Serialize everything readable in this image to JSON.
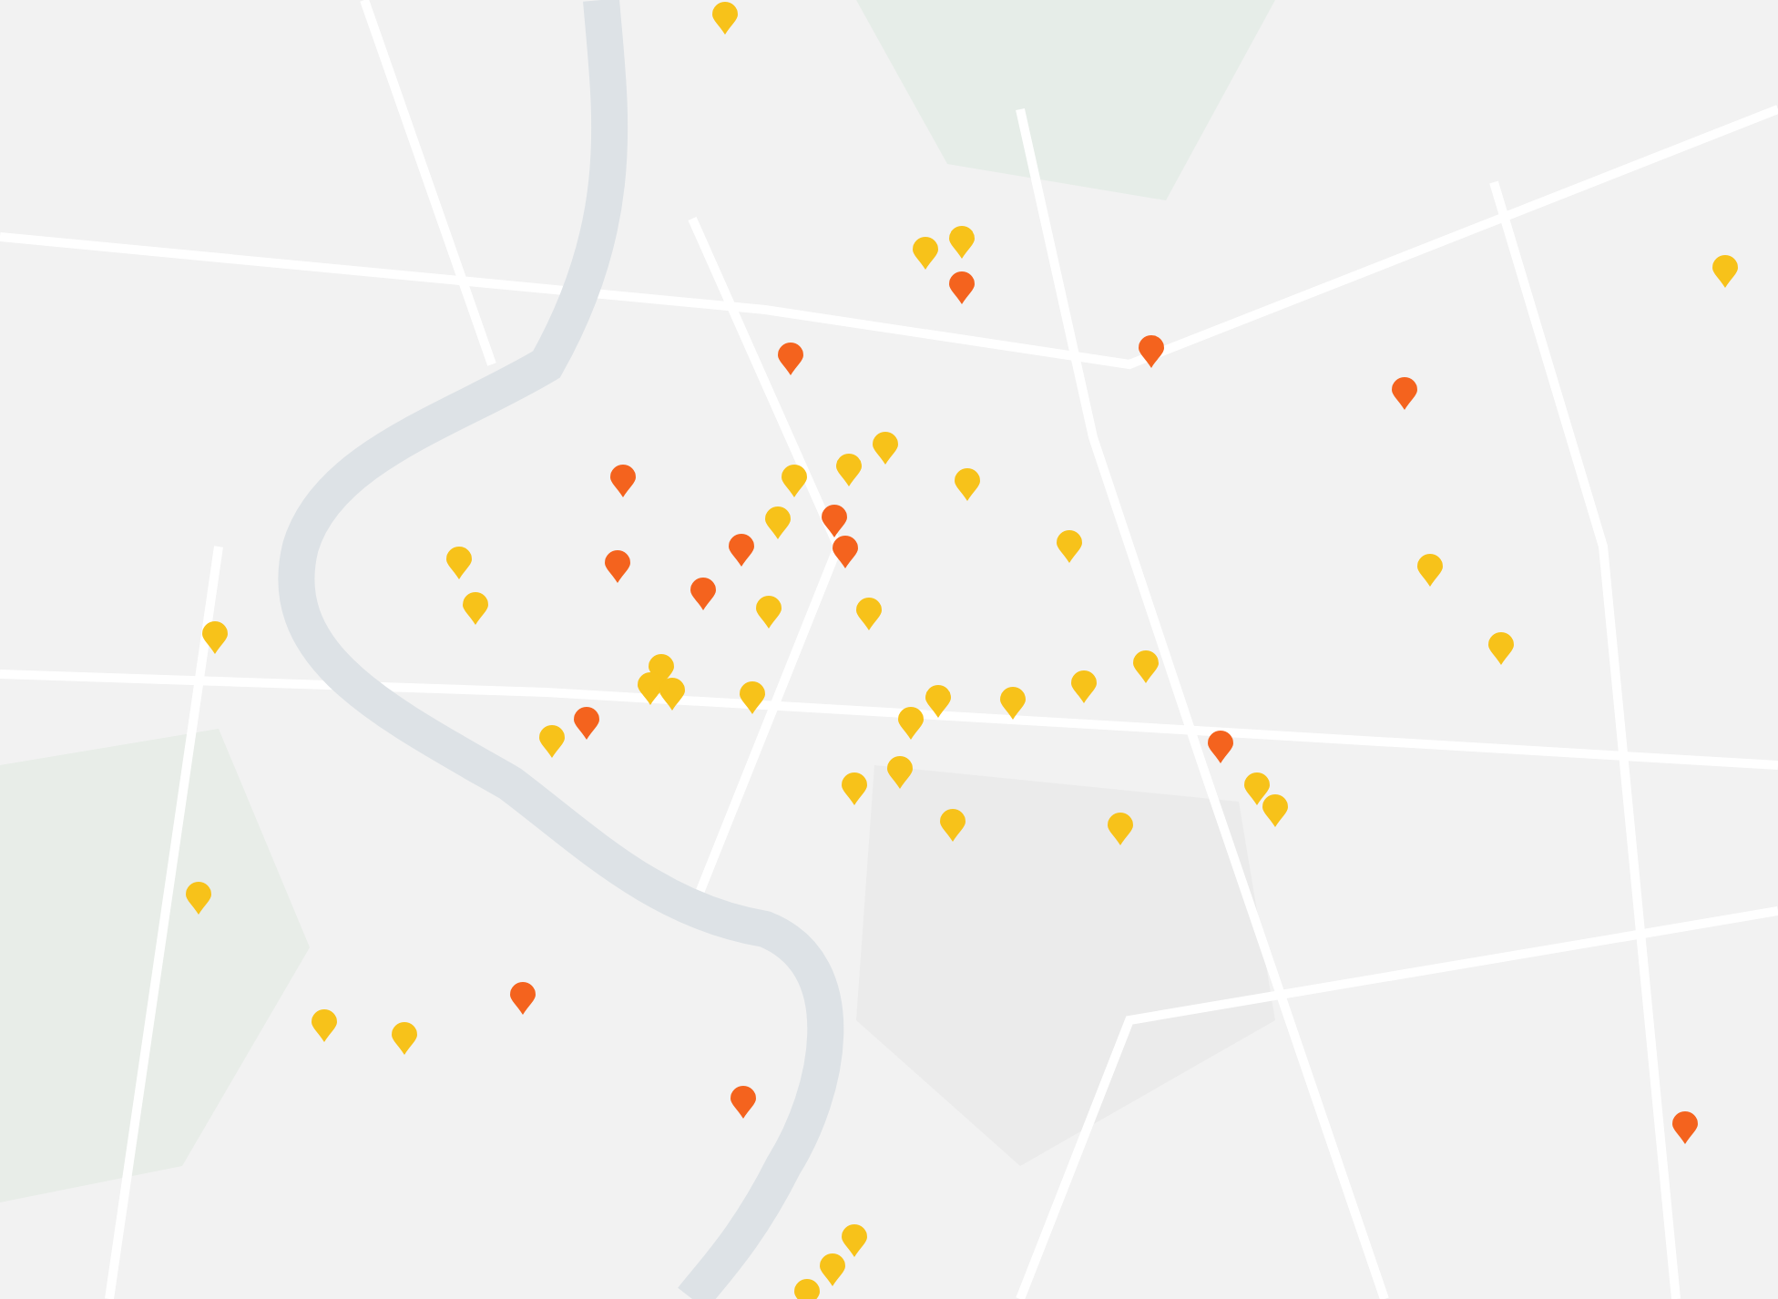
{
  "map": {
    "markers": [
      {
        "color": "#f7c21a"
      },
      {
        "color": "#f7c21a"
      },
      {
        "color": "#f7c21a"
      },
      {
        "color": "#f7c21a"
      },
      {
        "color": "#f7c21a"
      },
      {
        "color": "#f7c21a"
      },
      {
        "color": "#f7c21a"
      },
      {
        "color": "#f7c21a"
      },
      {
        "color": "#f7c21a"
      },
      {
        "color": "#f7c21a"
      },
      {
        "color": "#f7c21a"
      },
      {
        "color": "#f7c21a"
      },
      {
        "color": "#f7c21a"
      },
      {
        "color": "#f7c21a"
      },
      {
        "color": "#f7c21a"
      },
      {
        "color": "#f7c21a"
      },
      {
        "color": "#f7c21a"
      },
      {
        "color": "#f7c21a"
      },
      {
        "color": "#f7c21a"
      },
      {
        "color": "#f7c21a"
      },
      {
        "color": "#f7c21a"
      },
      {
        "color": "#f7c21a"
      },
      {
        "color": "#f7c21a"
      },
      {
        "color": "#f7c21a"
      },
      {
        "color": "#f7c21a"
      },
      {
        "color": "#f7c21a"
      },
      {
        "color": "#f7c21a"
      },
      {
        "color": "#f7c21a"
      },
      {
        "color": "#f7c21a"
      },
      {
        "color": "#f7c21a"
      },
      {
        "color": "#f7c21a"
      },
      {
        "color": "#f7c21a"
      },
      {
        "color": "#f7c21a"
      },
      {
        "color": "#f7c21a"
      },
      {
        "color": "#f7c21a"
      },
      {
        "color": "#f7c21a"
      },
      {
        "color": "#f7c21a"
      },
      {
        "color": "#f7c21a"
      },
      {
        "color": "#f7c21a"
      },
      {
        "color": "#f4631e"
      },
      {
        "color": "#f4631e"
      },
      {
        "color": "#f4631e"
      },
      {
        "color": "#f4631e"
      },
      {
        "color": "#f4631e"
      },
      {
        "color": "#f4631e"
      },
      {
        "color": "#f4631e"
      },
      {
        "color": "#f4631e"
      },
      {
        "color": "#f4631e"
      },
      {
        "color": "#f4631e"
      },
      {
        "color": "#f4631e"
      },
      {
        "color": "#f4631e"
      },
      {
        "color": "#f4631e"
      },
      {
        "color": "#f4631e"
      },
      {
        "color": "#f4631e"
      }
    ]
  }
}
